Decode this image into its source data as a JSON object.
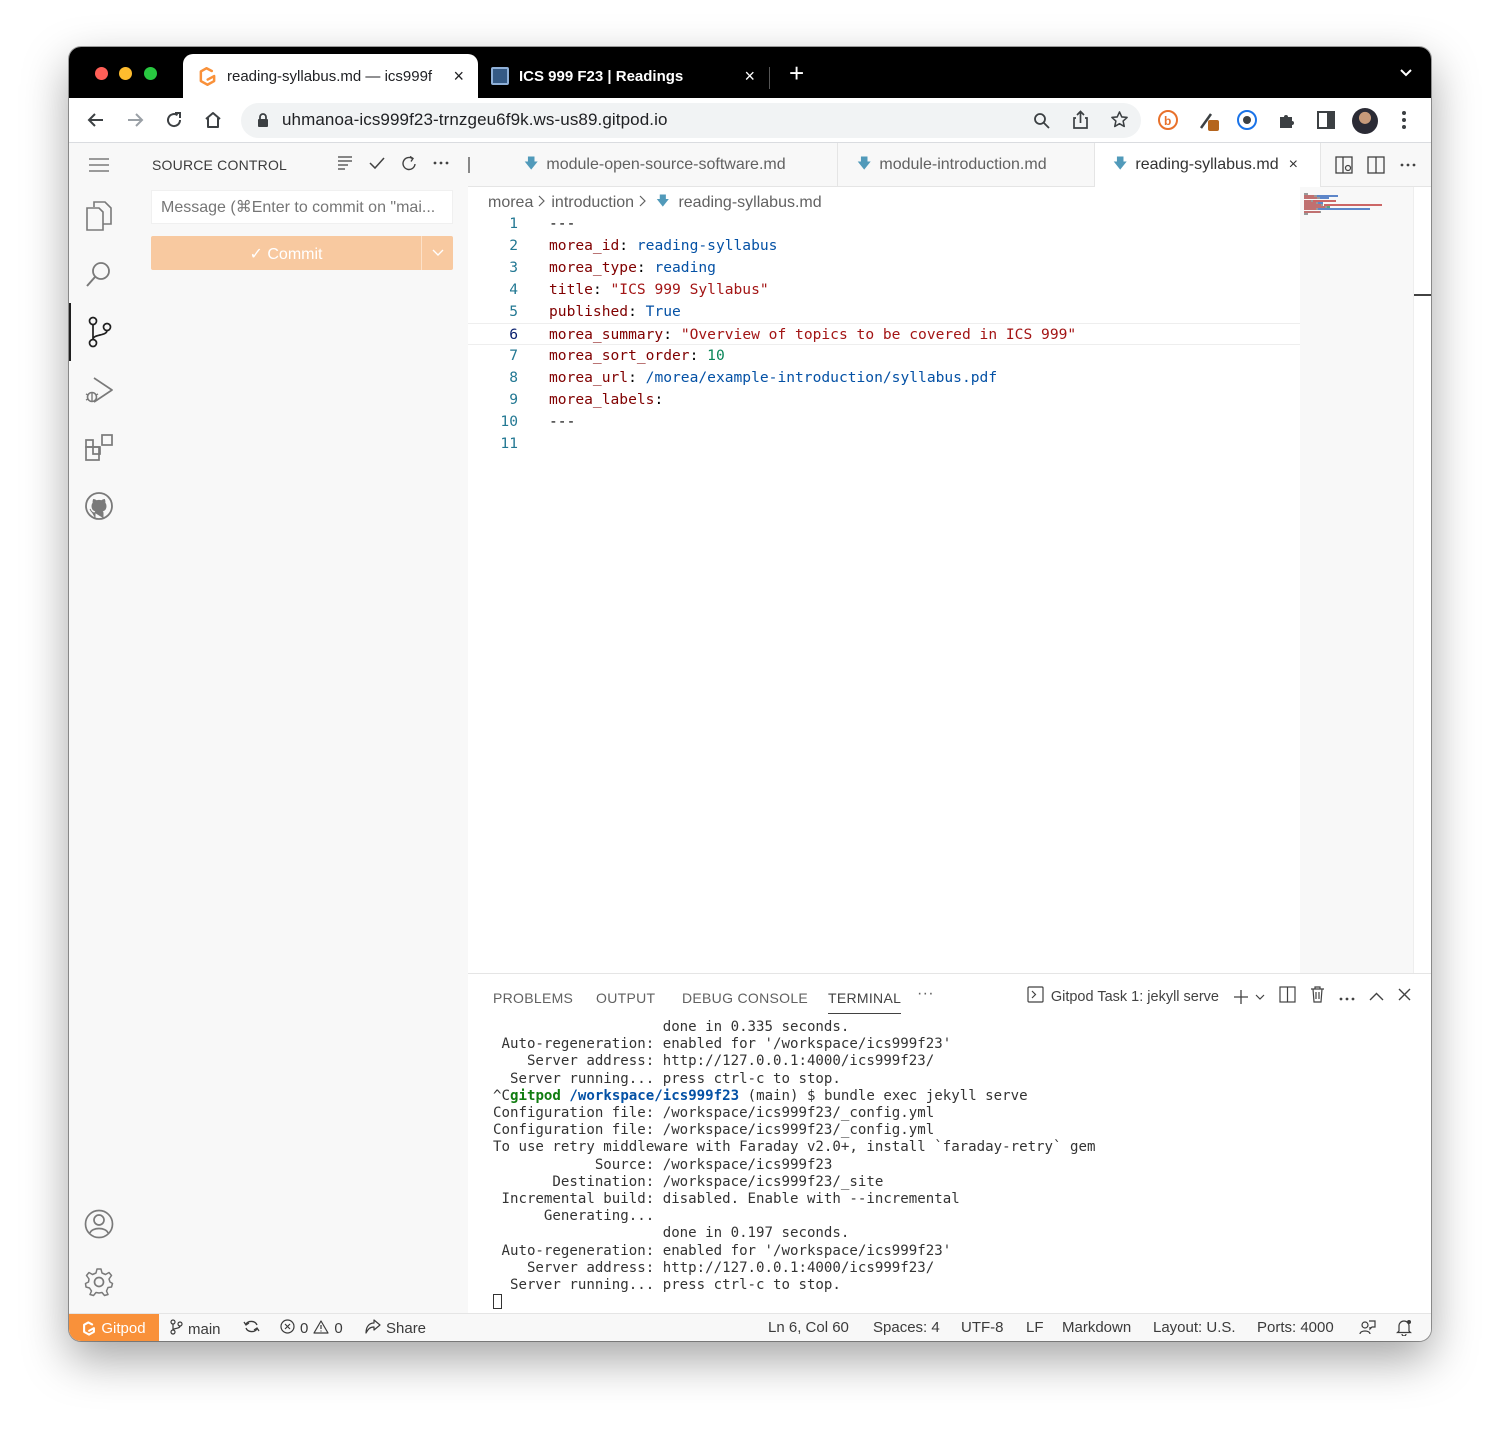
{
  "browser": {
    "tabs": [
      {
        "title": "reading-syllabus.md — ics999f",
        "close": "×"
      },
      {
        "title": "ICS 999 F23 | Readings",
        "close": "×"
      }
    ],
    "new_tab": "+",
    "url": "uhmanoa-ics999f23-trnzgeu6f9k.ws-us89.gitpod.io"
  },
  "sidebar": {
    "title": "SOURCE CONTROL",
    "message_placeholder": "Message (⌘Enter to commit on \"mai...",
    "commit_label": "✓ Commit"
  },
  "editor": {
    "tabs": [
      {
        "label": "module-open-source-software.md"
      },
      {
        "label": "module-introduction.md"
      },
      {
        "label": "reading-syllabus.md",
        "close": "×"
      }
    ],
    "breadcrumb": [
      "morea",
      "introduction",
      "reading-syllabus.md"
    ],
    "lines": [
      {
        "n": "1",
        "parts": [
          [
            "p",
            "---"
          ]
        ]
      },
      {
        "n": "2",
        "parts": [
          [
            "k",
            "morea_id"
          ],
          [
            "p",
            ": "
          ],
          [
            "v",
            "reading-syllabus"
          ]
        ]
      },
      {
        "n": "3",
        "parts": [
          [
            "k",
            "morea_type"
          ],
          [
            "p",
            ": "
          ],
          [
            "v",
            "reading"
          ]
        ]
      },
      {
        "n": "4",
        "parts": [
          [
            "k",
            "title"
          ],
          [
            "p",
            ": "
          ],
          [
            "s",
            "\"ICS 999 Syllabus\""
          ]
        ]
      },
      {
        "n": "5",
        "parts": [
          [
            "k",
            "published"
          ],
          [
            "p",
            ": "
          ],
          [
            "v",
            "True"
          ]
        ]
      },
      {
        "n": "6",
        "parts": [
          [
            "k",
            "morea_summary"
          ],
          [
            "p",
            ": "
          ],
          [
            "s",
            "\"Overview of topics to be covered in ICS 999\""
          ]
        ]
      },
      {
        "n": "7",
        "parts": [
          [
            "k",
            "morea_sort_order"
          ],
          [
            "p",
            ": "
          ],
          [
            "n",
            "10"
          ]
        ]
      },
      {
        "n": "8",
        "parts": [
          [
            "k",
            "morea_url"
          ],
          [
            "p",
            ": "
          ],
          [
            "v",
            "/morea/example-introduction/syllabus.pdf"
          ]
        ]
      },
      {
        "n": "9",
        "parts": [
          [
            "k",
            "morea_labels"
          ],
          [
            "p",
            ":"
          ]
        ]
      },
      {
        "n": "10",
        "parts": [
          [
            "p",
            "---"
          ]
        ]
      },
      {
        "n": "11",
        "parts": []
      }
    ],
    "current_line": "6"
  },
  "panel": {
    "tabs": [
      "PROBLEMS",
      "OUTPUT",
      "DEBUG CONSOLE",
      "TERMINAL"
    ],
    "more": "···",
    "task": "Gitpod Task 1: jekyll serve",
    "terminal": {
      "pre": "                    done in 0.335 seconds.\n Auto-regeneration: enabled for '/workspace/ics999f23'\n    Server address: http://127.0.0.1:4000/ics999f23/\n  Server running... press ctrl-c to stop.\n^C",
      "prompt_user": "gitpod",
      "prompt_path": "/workspace/ics999f23",
      "prompt_cmd": " (main) $ bundle exec jekyll serve",
      "post": "Configuration file: /workspace/ics999f23/_config.yml\nConfiguration file: /workspace/ics999f23/_config.yml\nTo use retry middleware with Faraday v2.0+, install `faraday-retry` gem\n            Source: /workspace/ics999f23\n       Destination: /workspace/ics999f23/_site\n Incremental build: disabled. Enable with --incremental\n      Generating...\n                    done in 0.197 seconds.\n Auto-regeneration: enabled for '/workspace/ics999f23'\n    Server address: http://127.0.0.1:4000/ics999f23/\n  Server running... press ctrl-c to stop.\n"
    }
  },
  "status": {
    "gitpod": "Gitpod",
    "branch": "main",
    "errors": "0",
    "warnings": "0",
    "share": "Share",
    "position": "Ln 6, Col 60",
    "spaces": "Spaces: 4",
    "encoding": "UTF-8",
    "eol": "LF",
    "language": "Markdown",
    "layout": "Layout: U.S.",
    "ports": "Ports: 4000"
  },
  "colors": {
    "accent": "#f9913a",
    "commit_button": "#f8c9a0",
    "yaml_key": "#800000",
    "yaml_value": "#0451a5",
    "yaml_string": "#a31515",
    "yaml_number": "#098658"
  }
}
